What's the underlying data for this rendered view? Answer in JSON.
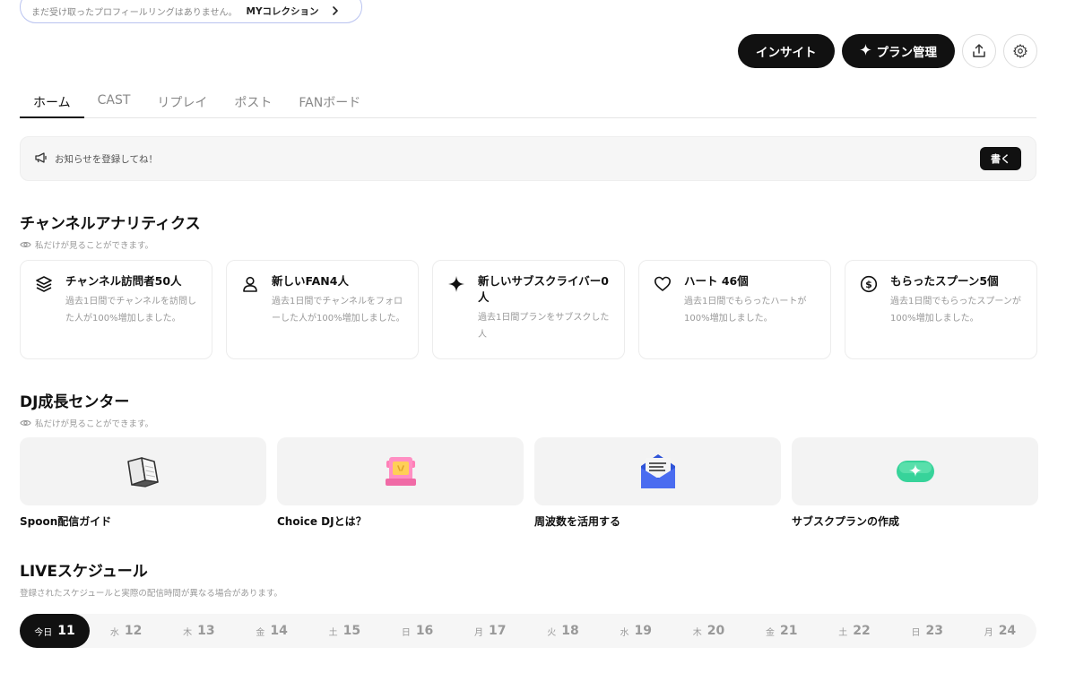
{
  "notice_pill": {
    "text": "まだ受け取ったプロフィールリングはありません。",
    "link": "MYコレクション"
  },
  "actions": {
    "insight": "インサイト",
    "plan_manage": "プラン管理"
  },
  "tabs": [
    {
      "label": "ホーム",
      "active": true
    },
    {
      "label": "CAST",
      "active": false
    },
    {
      "label": "リプレイ",
      "active": false
    },
    {
      "label": "ポスト",
      "active": false
    },
    {
      "label": "FANボード",
      "active": false
    }
  ],
  "notice_bar": {
    "text": "お知らせを登録してね！",
    "button": "書く"
  },
  "analytics": {
    "title": "チャンネルアナリティクス",
    "note": "私だけが見ることができます。",
    "cards": [
      {
        "icon": "layers-icon",
        "title": "チャンネル訪問者50人",
        "desc": "過去1日間でチャンネルを訪問した人が100%増加しました。"
      },
      {
        "icon": "person-icon",
        "title": "新しいFAN4人",
        "desc": "過去1日間でチャンネルをフォローした人が100%増加しました。"
      },
      {
        "icon": "sparkle-icon",
        "title": "新しいサブスクライバー0人",
        "desc": "過去1日間プランをサブスクした人"
      },
      {
        "icon": "heart-icon",
        "title": "ハート 46個",
        "desc": "過去1日間でもらったハートが100%増加しました。"
      },
      {
        "icon": "coin-icon",
        "title": "もらったスプーン5個",
        "desc": "過去1日間でもらったスプーンが100%増加しました。"
      }
    ]
  },
  "growth": {
    "title": "DJ成長センター",
    "note": "私だけが見ることができます。",
    "items": [
      {
        "icon": "book-icon",
        "label": "Spoon配信ガイド"
      },
      {
        "icon": "gift-box-icon",
        "label": "Choice DJとは？"
      },
      {
        "icon": "envelope-icon",
        "label": "周波数を活用する"
      },
      {
        "icon": "sparkle-pill-icon",
        "label": "サブスクプランの作成"
      }
    ]
  },
  "schedule": {
    "title": "LIVEスケジュール",
    "note": "登録されたスケジュールと実際の配信時間が異なる場合があります。",
    "days": [
      {
        "wd": "今日",
        "d": "11",
        "today": true
      },
      {
        "wd": "水",
        "d": "12"
      },
      {
        "wd": "木",
        "d": "13"
      },
      {
        "wd": "金",
        "d": "14"
      },
      {
        "wd": "土",
        "d": "15"
      },
      {
        "wd": "日",
        "d": "16"
      },
      {
        "wd": "月",
        "d": "17"
      },
      {
        "wd": "火",
        "d": "18"
      },
      {
        "wd": "水",
        "d": "19"
      },
      {
        "wd": "木",
        "d": "20"
      },
      {
        "wd": "金",
        "d": "21"
      },
      {
        "wd": "土",
        "d": "22"
      },
      {
        "wd": "日",
        "d": "23"
      },
      {
        "wd": "月",
        "d": "24"
      }
    ]
  }
}
